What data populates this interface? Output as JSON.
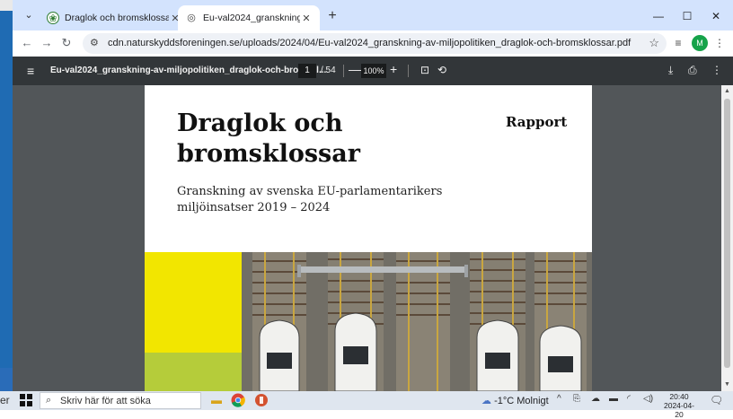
{
  "desktop": {
    "label": "er"
  },
  "tabs": [
    {
      "title": "Draglok och bromsklossar– gr...",
      "active": false
    },
    {
      "title": "Eu-val2024_granskning-av-milj",
      "active": true
    }
  ],
  "toolbar": {
    "url": "cdn.naturskyddsforeningen.se/uploads/2024/04/Eu-val2024_granskning-av-miljopolitiken_draglok-och-bromsklossar.pdf",
    "avatar_initial": "M"
  },
  "pdf_toolbar": {
    "doc_title": "Eu-val2024_granskning-av-miljopolitiken_draglok-och-bromskl...",
    "current_page": "1",
    "total_pages": "/ 54",
    "zoom": "100%"
  },
  "page": {
    "title": "Draglok och bromsklossar",
    "badge": "Rapport",
    "subtitle": "Granskning av svenska EU-parlamentarikers miljöinsatser 2019 – 2024"
  },
  "taskbar": {
    "search_placeholder": "Skriv här för att söka",
    "weather": "-1°C Molnigt",
    "time": "20:40",
    "date": "2024-04-20"
  },
  "colors": {
    "tab_strip": "#d3e3fd",
    "pdf_toolbar": "#323639",
    "pdf_background": "#525659",
    "cover_yellow": "#f2e600",
    "cover_green": "#b5cc3a"
  }
}
